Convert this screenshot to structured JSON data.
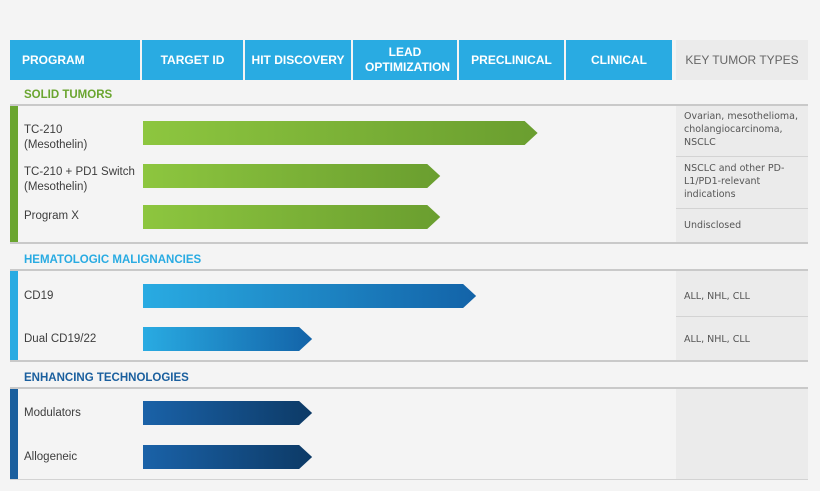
{
  "header": {
    "program": "PROGRAM",
    "stages": [
      "TARGET ID",
      "HIT DISCOVERY",
      "LEAD OPTIMIZATION",
      "PRECLINICAL",
      "CLINICAL"
    ],
    "key": "KEY TUMOR TYPES"
  },
  "colors": {
    "header": "#29abe2",
    "solid": "#6aa52f",
    "heme": "#29abe2",
    "tech": "#1a5f9e",
    "green_start": "#8dc63f",
    "green_end": "#6a9e2f",
    "blue_start": "#29abe2",
    "blue_end": "#1363a8",
    "navy_start": "#1a62a8",
    "navy_end": "#0d3a66"
  },
  "chart_data": {
    "type": "bar",
    "orientation": "horizontal",
    "stage_axis": [
      "TARGET ID",
      "HIT DISCOVERY",
      "LEAD OPTIMIZATION",
      "PRECLINICAL",
      "CLINICAL"
    ],
    "sections": [
      {
        "title": "SOLID TUMORS",
        "programs": [
          {
            "name": "TC-210",
            "sub": "(Mesothelin)",
            "progress": 3.85,
            "key": "Ovarian, mesothelioma, cholangiocarcinoma, NSCLC"
          },
          {
            "name": "TC-210 + PD1 Switch",
            "sub": "(Mesothelin)",
            "progress": 2.9,
            "key": "NSCLC and other PD-L1/PD1-relevant indications"
          },
          {
            "name": "Program X",
            "sub": "",
            "progress": 2.9,
            "key": "Undisclosed"
          }
        ]
      },
      {
        "title": "HEMATOLOGIC MALIGNANCIES",
        "programs": [
          {
            "name": "CD19",
            "sub": "",
            "progress": 3.25,
            "key": "ALL, NHL, CLL"
          },
          {
            "name": "Dual CD19/22",
            "sub": "",
            "progress": 1.65,
            "key": "ALL, NHL, CLL"
          }
        ]
      },
      {
        "title": "ENHANCING TECHNOLOGIES",
        "programs": [
          {
            "name": "Modulators",
            "sub": "",
            "progress": 1.65,
            "key": ""
          },
          {
            "name": "Allogeneic",
            "sub": "",
            "progress": 1.65,
            "key": ""
          }
        ]
      }
    ]
  }
}
